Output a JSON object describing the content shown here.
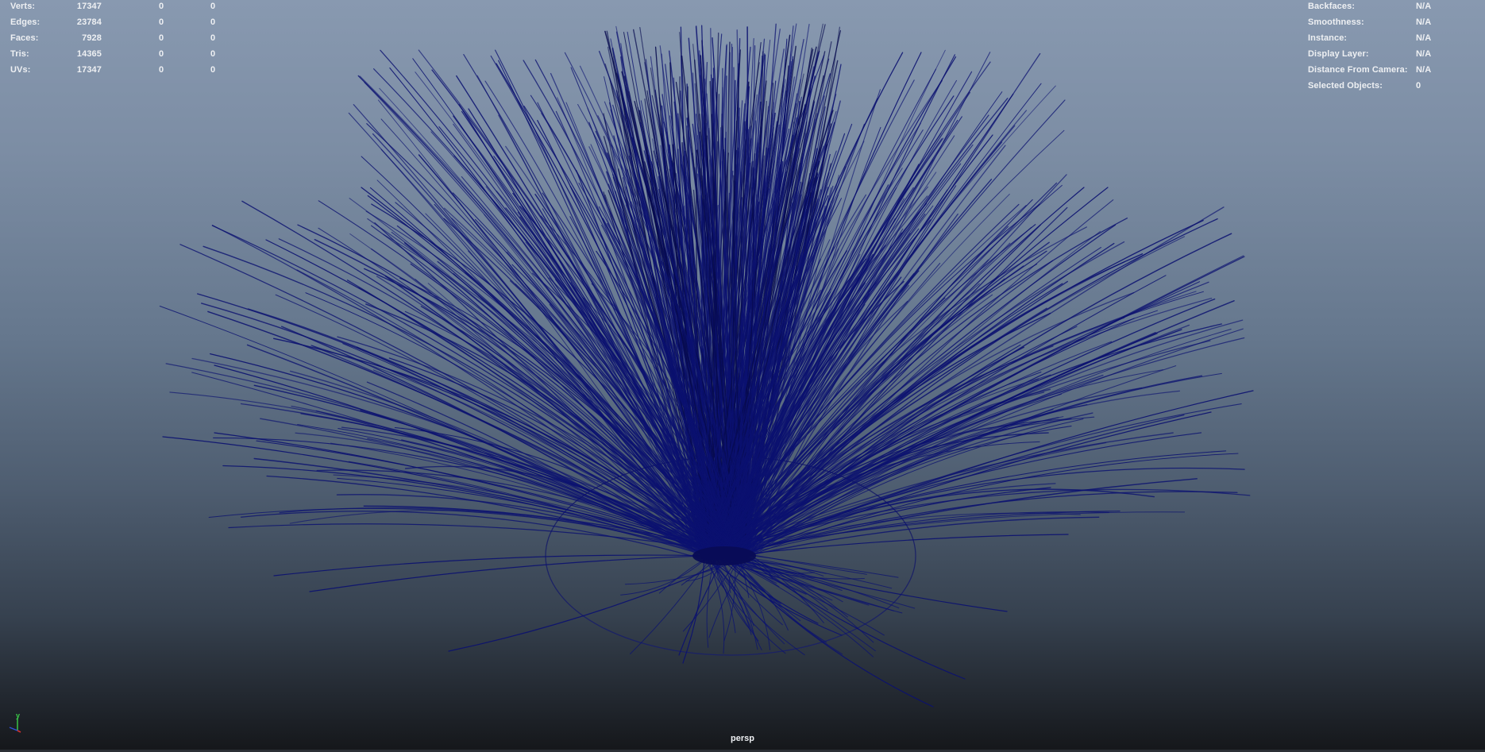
{
  "viewport": {
    "camera": "persp"
  },
  "stats": {
    "rows": [
      {
        "label": "Verts:",
        "v1": "17347",
        "v2": "0",
        "v3": "0"
      },
      {
        "label": "Edges:",
        "v1": "23784",
        "v2": "0",
        "v3": "0"
      },
      {
        "label": "Faces:",
        "v1": "7928",
        "v2": "0",
        "v3": "0"
      },
      {
        "label": "Tris:",
        "v1": "14365",
        "v2": "0",
        "v3": "0"
      },
      {
        "label": "UVs:",
        "v1": "17347",
        "v2": "0",
        "v3": "0"
      }
    ]
  },
  "info": {
    "rows": [
      {
        "label": "Backfaces:",
        "value": "N/A"
      },
      {
        "label": "Smoothness:",
        "value": "N/A"
      },
      {
        "label": "Instance:",
        "value": "N/A"
      },
      {
        "label": "Display Layer:",
        "value": "N/A"
      },
      {
        "label": "Distance From Camera:",
        "value": "N/A"
      },
      {
        "label": "Selected Objects:",
        "value": "0"
      }
    ]
  },
  "axis": {
    "y_label": "y",
    "colors": {
      "x": "#d33030",
      "y": "#3ccf4a",
      "z": "#3050d8"
    }
  },
  "colors": {
    "strand": "#0b1170",
    "strand_dark": "#070b4e",
    "ground_circle": "#1a2166"
  }
}
